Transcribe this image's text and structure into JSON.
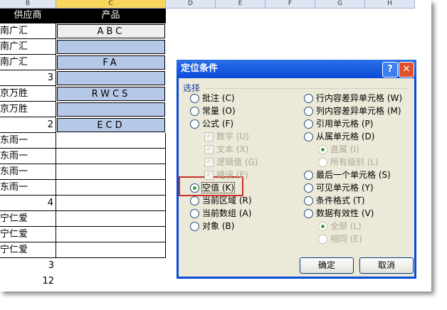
{
  "columns": [
    "B",
    "C",
    "D",
    "E",
    "F",
    "G",
    "H"
  ],
  "headers": {
    "b": "供应商",
    "c": "产品"
  },
  "rows": [
    {
      "b": "南广汇",
      "c": "ABC"
    },
    {
      "b": "南广汇",
      "c": ""
    },
    {
      "b": "南广汇",
      "c": "FA"
    },
    {
      "b": "3",
      "c": ""
    },
    {
      "b": "京万胜",
      "c": "RWCS"
    },
    {
      "b": "京万胜",
      "c": ""
    },
    {
      "b": "2",
      "c": "ECD"
    },
    {
      "b": "东雨一",
      "c": ""
    },
    {
      "b": "东雨一",
      "c": ""
    },
    {
      "b": "东雨一",
      "c": ""
    },
    {
      "b": "东雨一",
      "c": ""
    },
    {
      "b": "4",
      "c": ""
    },
    {
      "b": "宁仁爱",
      "c": ""
    },
    {
      "b": "宁仁爱",
      "c": ""
    },
    {
      "b": "宁仁爱",
      "c": ""
    },
    {
      "b": "3",
      "c": ""
    },
    {
      "b": "12",
      "c": ""
    }
  ],
  "dialog": {
    "title": "定位条件",
    "help": "?",
    "close": "✕",
    "group": "选择",
    "left": [
      {
        "label": "批注 (C)",
        "type": "radio"
      },
      {
        "label": "常量 (O)",
        "type": "radio"
      },
      {
        "label": "公式 (F)",
        "type": "radio"
      },
      {
        "label": "数字 (U)",
        "type": "check",
        "disabled": true
      },
      {
        "label": "文本 (X)",
        "type": "check",
        "disabled": true
      },
      {
        "label": "逻辑值 (G)",
        "type": "check",
        "disabled": true
      },
      {
        "label": "错误 (E)",
        "type": "check",
        "disabled": true
      },
      {
        "label": "空值 (K)",
        "type": "radio",
        "checked": true
      },
      {
        "label": "当前区域 (R)",
        "type": "radio"
      },
      {
        "label": "当前数组 (A)",
        "type": "radio"
      },
      {
        "label": "对象 (B)",
        "type": "radio"
      }
    ],
    "right": [
      {
        "label": "行内容差异单元格 (W)",
        "type": "radio"
      },
      {
        "label": "列内容差异单元格 (M)",
        "type": "radio"
      },
      {
        "label": "引用单元格 (P)",
        "type": "radio"
      },
      {
        "label": "从属单元格 (D)",
        "type": "radio"
      },
      {
        "label": "直属 (I)",
        "type": "radio",
        "disabled": true,
        "sub": true,
        "checked": true
      },
      {
        "label": "所有级别 (L)",
        "type": "radio",
        "disabled": true,
        "sub": true
      },
      {
        "label": "最后一个单元格 (S)",
        "type": "radio"
      },
      {
        "label": "可见单元格 (Y)",
        "type": "radio"
      },
      {
        "label": "条件格式 (T)",
        "type": "radio"
      },
      {
        "label": "数据有效性 (V)",
        "type": "radio"
      },
      {
        "label": "全部 (L)",
        "type": "radio",
        "disabled": true,
        "sub": true,
        "checked": true
      },
      {
        "label": "相同 (E)",
        "type": "radio",
        "disabled": true,
        "sub": true
      }
    ],
    "ok": "确定",
    "cancel": "取消"
  }
}
